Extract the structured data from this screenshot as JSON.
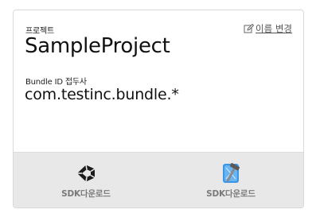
{
  "project": {
    "label": "프로젝트",
    "rename_label": "이름 변경",
    "name": "SampleProject",
    "bundle_label": "Bundle ID 접두사",
    "bundle_id": "com.testinc.bundle.*"
  },
  "downloads": {
    "unity": {
      "label": "SDK다운로드",
      "icon": "unity-icon"
    },
    "xcode": {
      "label": "SDK다운로드",
      "icon": "xcode-icon"
    }
  },
  "colors": {
    "border": "#d9d9d9",
    "footer_bg": "#e8e8e8",
    "xcode_blue": "#2f8fe0"
  }
}
